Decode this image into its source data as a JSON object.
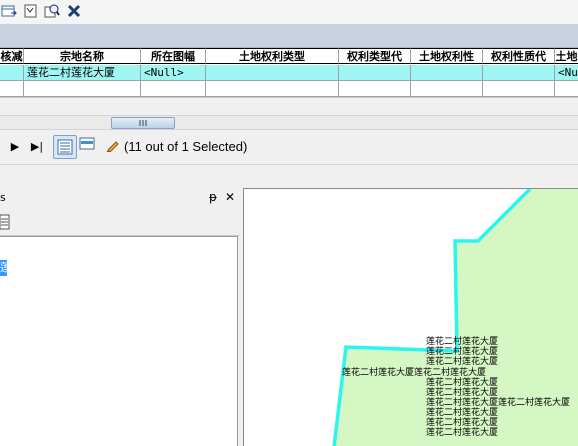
{
  "toolbar": {
    "icons": [
      "table-options-icon",
      "select-by-attributes-icon",
      "zoom-to-selected-icon",
      "delete-selected-icon"
    ]
  },
  "table": {
    "columns": [
      "核减",
      "宗地名称",
      "所在图幅",
      "土地权利类型",
      "权利类型代",
      "土地权利性",
      "权利性质代",
      "土地"
    ],
    "rows": [
      [
        "",
        "莲花二村莲花大厦",
        "<Null>",
        "",
        "",
        "",
        "",
        "<Nu"
      ],
      [
        "",
        "",
        "",
        "",
        "",
        "",
        "",
        ""
      ]
    ],
    "selected_row_color": "#9ff5f2"
  },
  "navigation": {
    "next_symbol": "▶",
    "last_symbol": "▶|",
    "selection_text": "(11 out of 1 Selected)"
  },
  "panel": {
    "title": "s",
    "pin_symbol": "ᵽ",
    "close_symbol": "✕",
    "selected_item_text": "莲"
  },
  "map": {
    "polygon_fill": "#d5f7c4",
    "outline_color": "#2af5f1",
    "labels": [
      "莲花二村莲花大厦",
      "莲花二村莲花大厦",
      "莲花二村莲花大厦",
      "莲花二村莲花大厦莲花二村莲花大厦",
      "莲花二村莲花大厦",
      "莲花二村莲花大厦",
      "莲花二村莲花大厦莲花二村莲花大厦",
      "莲花二村莲花大厦",
      "莲花二村莲花大厦",
      "莲花二村莲花大厦"
    ]
  }
}
